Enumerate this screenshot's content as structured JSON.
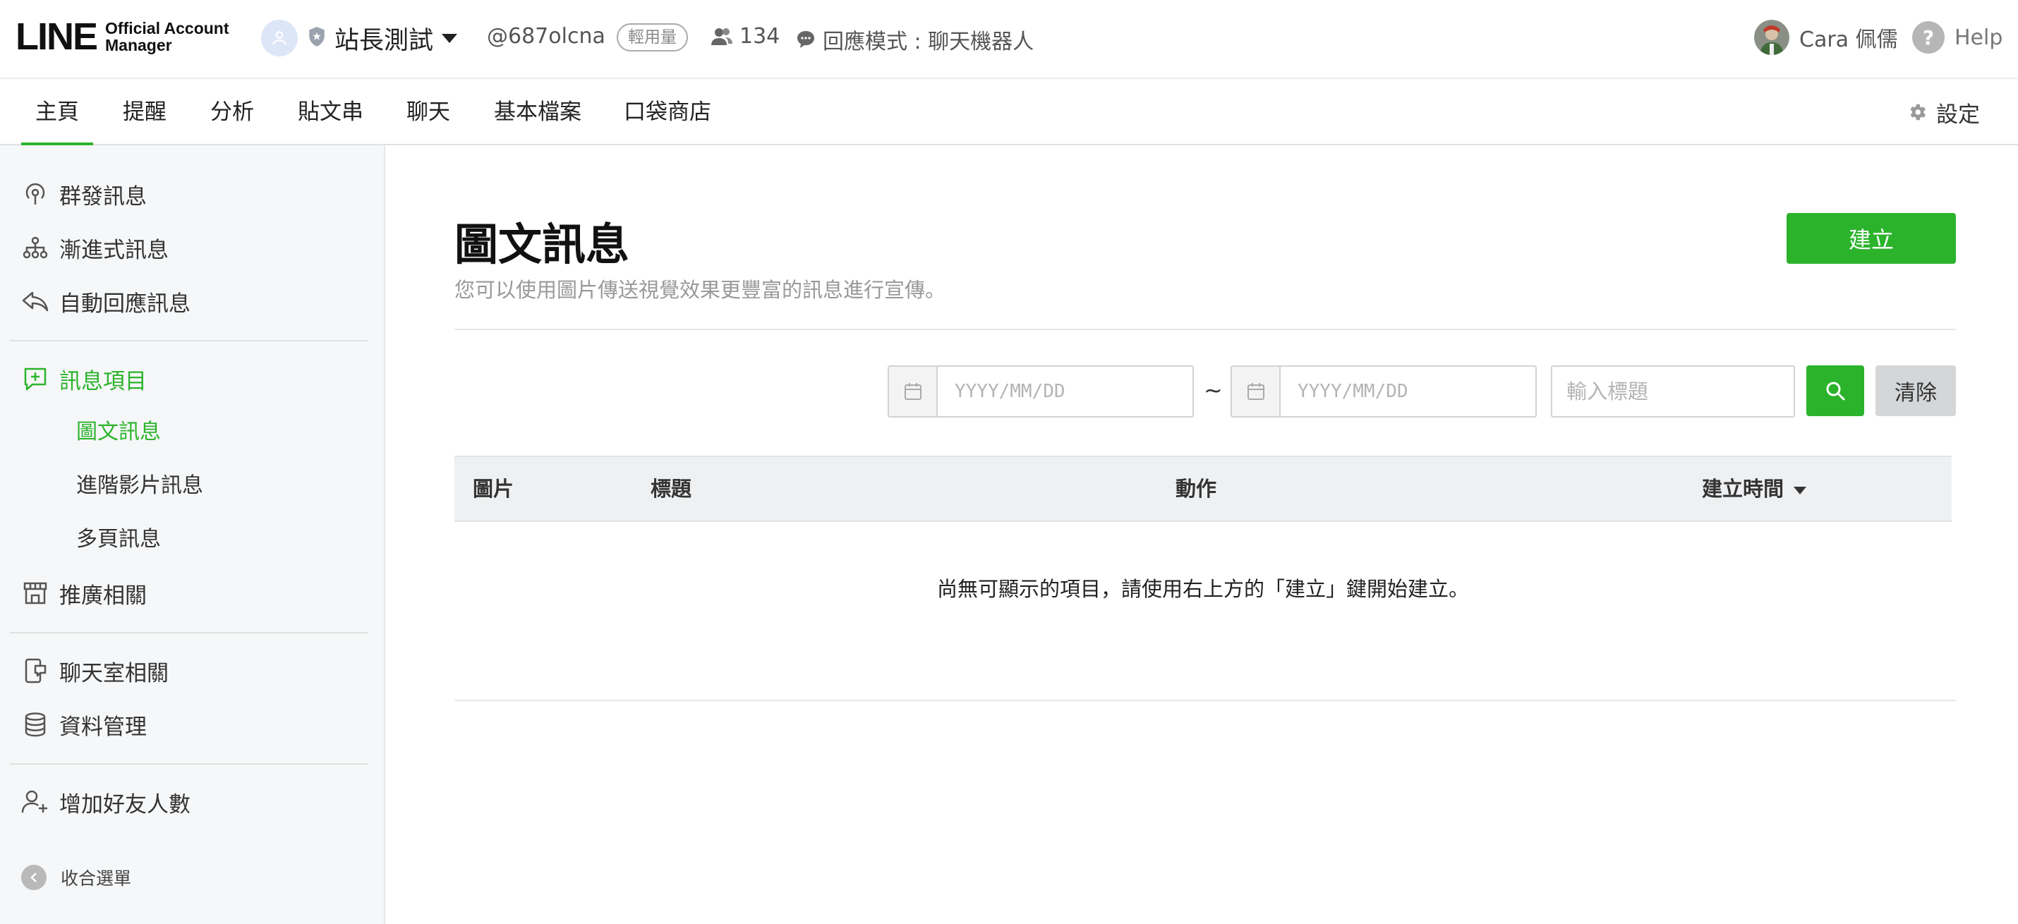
{
  "header": {
    "logo_main": "LINE",
    "logo_sub_1": "Official Account",
    "logo_sub_2": "Manager",
    "account_name": "站長測試",
    "account_id": "@687olcna",
    "plan_badge": "輕用量",
    "friend_count": "134",
    "reply_mode": "回應模式 : 聊天機器人",
    "user_name": "Cara 佩儒",
    "help_label": "Help"
  },
  "tabs": {
    "home": "主頁",
    "reminders": "提醒",
    "analytics": "分析",
    "timeline": "貼文串",
    "chat": "聊天",
    "profile": "基本檔案",
    "shop": "口袋商店",
    "settings": "設定"
  },
  "sidebar": {
    "broadcast": "群發訊息",
    "step_messages": "漸進式訊息",
    "auto_reply": "自動回應訊息",
    "message_items": "訊息項目",
    "rich_messages": "圖文訊息",
    "rich_video": "進階影片訊息",
    "card_messages": "多頁訊息",
    "promotion": "推廣相關",
    "chat_room": "聊天室相關",
    "data_management": "資料管理",
    "gain_friends": "增加好友人數",
    "collapse": "收合選單"
  },
  "main": {
    "title": "圖文訊息",
    "description": "您可以使用圖片傳送視覺效果更豐富的訊息進行宣傳。",
    "create_button": "建立",
    "date_from_placeholder": "YYYY/MM/DD",
    "date_separator": "~",
    "date_to_placeholder": "YYYY/MM/DD",
    "title_placeholder": "輸入標題",
    "clear_button": "清除",
    "columns": {
      "image": "圖片",
      "title": "標題",
      "action": "動作",
      "created_at": "建立時間"
    },
    "empty_message": "尚無可顯示的項目，請使用右上方的「建立」鍵開始建立。"
  },
  "colors": {
    "accent": "#2cb32c",
    "sidebar_bg": "#f6f7f8",
    "table_header_bg": "#eff0f2",
    "clear_button_bg": "#d4d6d8"
  },
  "icons": {
    "broadcast": "broadcast-icon",
    "step": "hierarchy-icon",
    "auto_reply": "reply-arrow-icon",
    "message_items": "message-plus-icon",
    "promotion": "store-icon",
    "chat_room": "phone-chat-icon",
    "data": "database-icon",
    "friends": "add-user-icon",
    "calendar": "calendar-icon",
    "search": "search-icon",
    "settings": "gear-icon",
    "help": "help-icon"
  }
}
